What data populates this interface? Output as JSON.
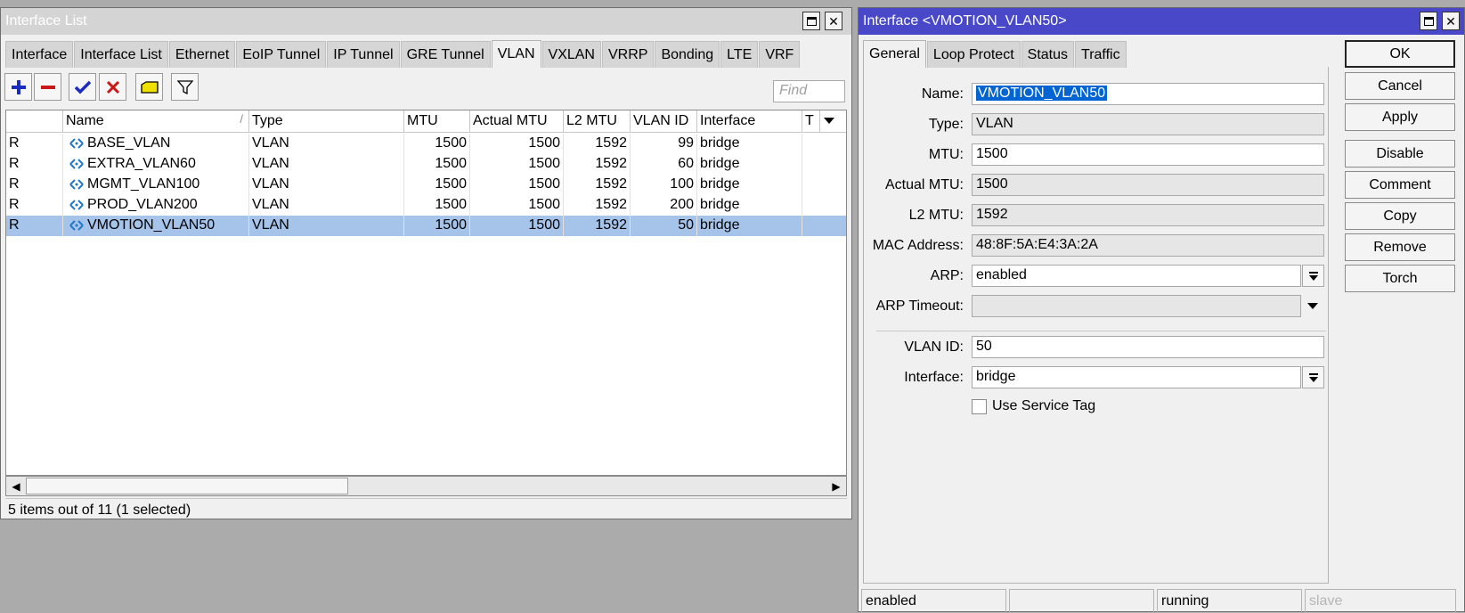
{
  "list_window": {
    "title": "Interface List",
    "tabs": [
      "Interface",
      "Interface List",
      "Ethernet",
      "EoIP Tunnel",
      "IP Tunnel",
      "GRE Tunnel",
      "VLAN",
      "VXLAN",
      "VRRP",
      "Bonding",
      "LTE",
      "VRF"
    ],
    "active_tab": "VLAN",
    "find_placeholder": "Find",
    "columns": {
      "flag": "",
      "name": "Name",
      "type": "Type",
      "mtu": "MTU",
      "actual_mtu": "Actual MTU",
      "l2_mtu": "L2 MTU",
      "vlan_id": "VLAN ID",
      "interface": "Interface",
      "extra": "T"
    },
    "rows": [
      {
        "flag": "R",
        "name": "BASE_VLAN",
        "type": "VLAN",
        "mtu": "1500",
        "actual_mtu": "1500",
        "l2_mtu": "1592",
        "vlan_id": "99",
        "interface": "bridge"
      },
      {
        "flag": "R",
        "name": "EXTRA_VLAN60",
        "type": "VLAN",
        "mtu": "1500",
        "actual_mtu": "1500",
        "l2_mtu": "1592",
        "vlan_id": "60",
        "interface": "bridge"
      },
      {
        "flag": "R",
        "name": "MGMT_VLAN100",
        "type": "VLAN",
        "mtu": "1500",
        "actual_mtu": "1500",
        "l2_mtu": "1592",
        "vlan_id": "100",
        "interface": "bridge"
      },
      {
        "flag": "R",
        "name": "PROD_VLAN200",
        "type": "VLAN",
        "mtu": "1500",
        "actual_mtu": "1500",
        "l2_mtu": "1592",
        "vlan_id": "200",
        "interface": "bridge"
      },
      {
        "flag": "R",
        "name": "VMOTION_VLAN50",
        "type": "VLAN",
        "mtu": "1500",
        "actual_mtu": "1500",
        "l2_mtu": "1592",
        "vlan_id": "50",
        "interface": "bridge"
      }
    ],
    "selected_row": 4,
    "status": "5 items out of 11 (1 selected)"
  },
  "dialog": {
    "title": "Interface <VMOTION_VLAN50>",
    "tabs": [
      "General",
      "Loop Protect",
      "Status",
      "Traffic"
    ],
    "active_tab": "General",
    "fields": {
      "name": {
        "label": "Name:",
        "value": "VMOTION_VLAN50"
      },
      "type": {
        "label": "Type:",
        "value": "VLAN"
      },
      "mtu": {
        "label": "MTU:",
        "value": "1500"
      },
      "actual_mtu": {
        "label": "Actual MTU:",
        "value": "1500"
      },
      "l2_mtu": {
        "label": "L2 MTU:",
        "value": "1592"
      },
      "mac": {
        "label": "MAC Address:",
        "value": "48:8F:5A:E4:3A:2A"
      },
      "arp": {
        "label": "ARP:",
        "value": "enabled"
      },
      "arp_timeout": {
        "label": "ARP Timeout:",
        "value": ""
      },
      "vlan_id": {
        "label": "VLAN ID:",
        "value": "50"
      },
      "interface": {
        "label": "Interface:",
        "value": "bridge"
      },
      "use_service_tag": {
        "label": "Use Service Tag",
        "checked": false
      }
    },
    "buttons": [
      "OK",
      "Cancel",
      "Apply",
      "Disable",
      "Comment",
      "Copy",
      "Remove",
      "Torch"
    ],
    "status_bar": [
      "enabled",
      "",
      "running",
      "slave"
    ]
  },
  "colors": {
    "dialog_title_bar": "#4848c8",
    "selected_row": "#a6c3ea",
    "text_selection": "#0064d2",
    "add_icon": "#1a2dbf",
    "remove_icon": "#c81818",
    "check_icon": "#1a2dbf",
    "cross_icon": "#c81818",
    "comment_icon": "#f0e000"
  }
}
